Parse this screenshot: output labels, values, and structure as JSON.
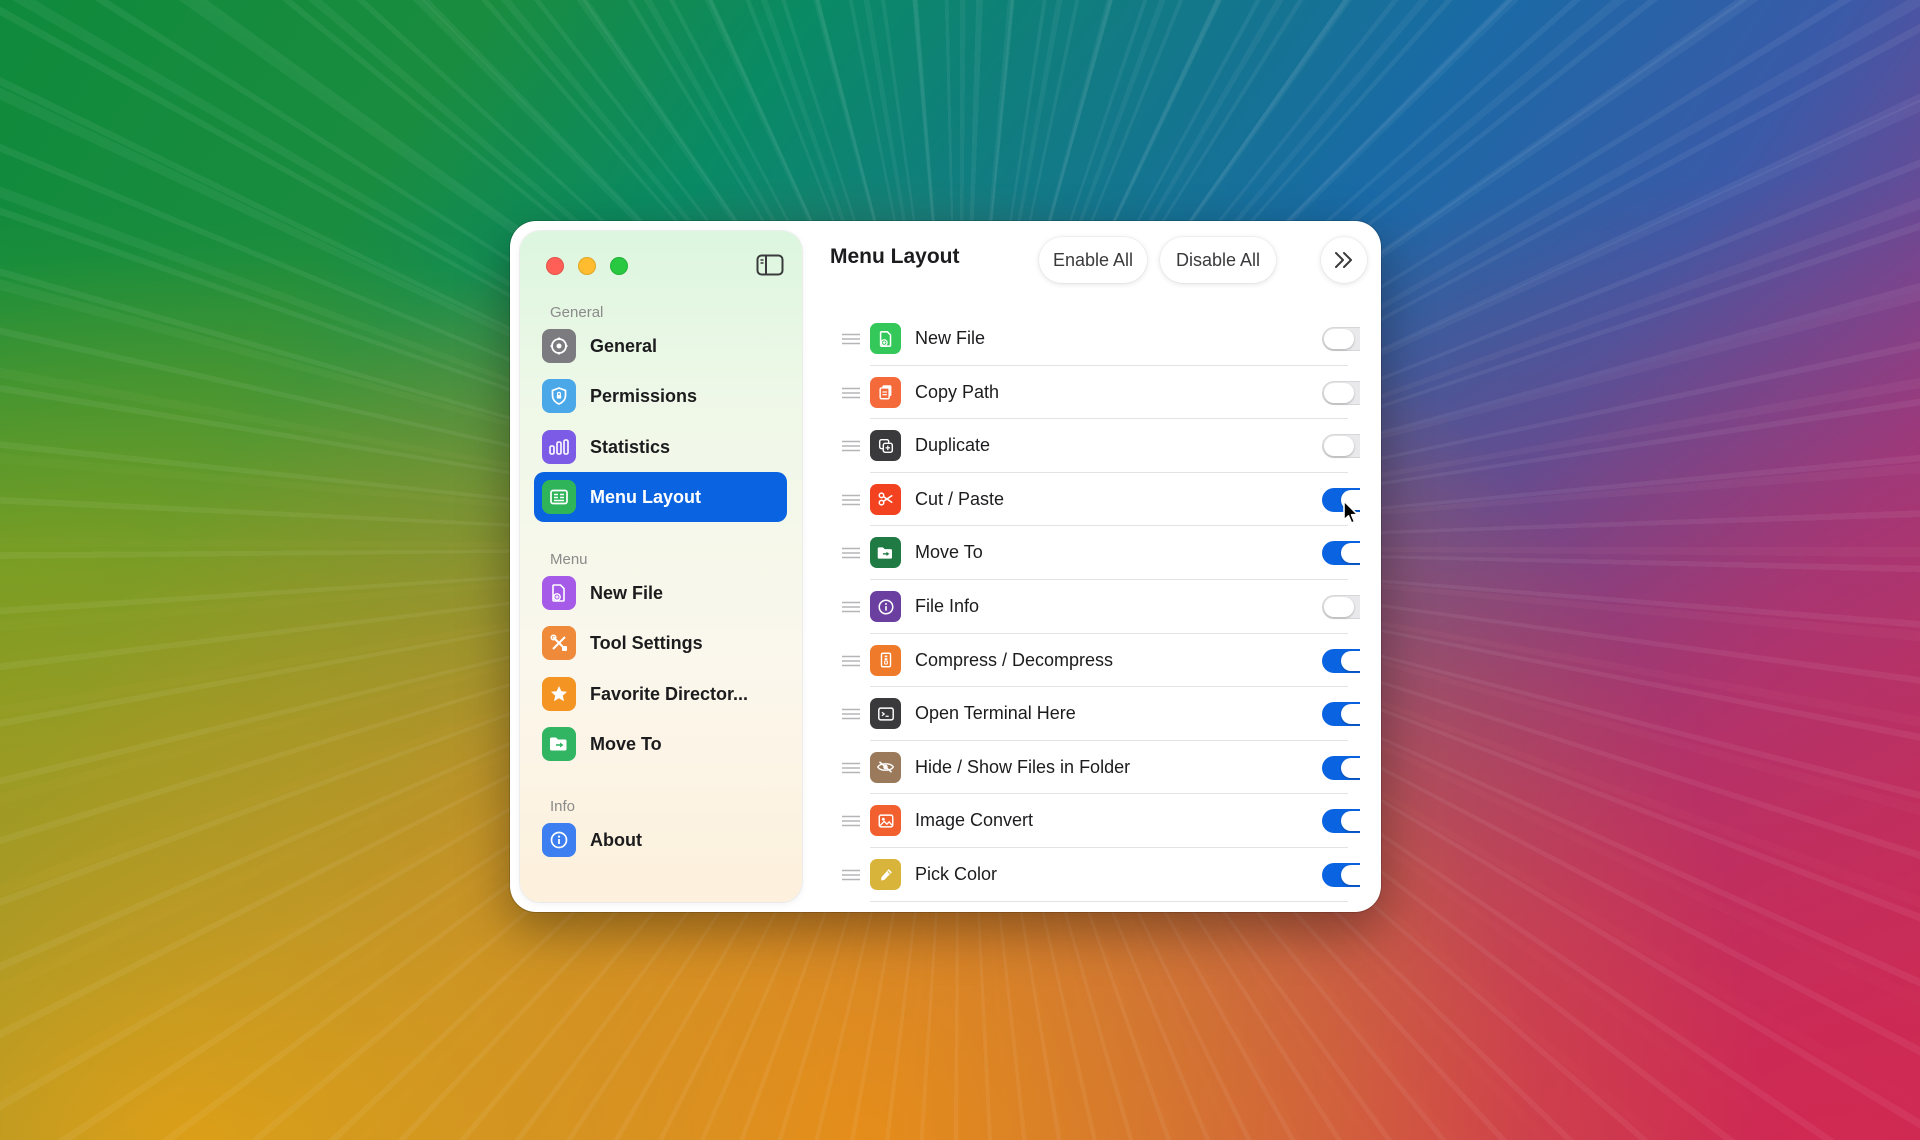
{
  "window": {
    "title": "Menu Layout",
    "enable_all_label": "Enable All",
    "disable_all_label": "Disable All"
  },
  "sidebar": {
    "sections": [
      {
        "header": "General",
        "items": [
          {
            "label": "General",
            "icon": "gear-icon",
            "color": "#7b7b80",
            "active": false
          },
          {
            "label": "Permissions",
            "icon": "shield-icon",
            "color": "#4aa8e8",
            "active": false
          },
          {
            "label": "Statistics",
            "icon": "bar-chart-icon",
            "color": "#7c5ce6",
            "active": false
          },
          {
            "label": "Menu Layout",
            "icon": "menu-layout-icon",
            "color": "#2fb45a",
            "active": true
          }
        ]
      },
      {
        "header": "Menu",
        "items": [
          {
            "label": "New File",
            "icon": "new-file-icon",
            "color": "#a55ae8",
            "active": false
          },
          {
            "label": "Tool Settings",
            "icon": "tools-icon",
            "color": "#ef8a3a",
            "active": false
          },
          {
            "label": "Favorite Director...",
            "icon": "star-icon",
            "color": "#f39423",
            "active": false
          },
          {
            "label": "Move To",
            "icon": "folder-move-icon",
            "color": "#32b563",
            "active": false
          }
        ]
      },
      {
        "header": "Info",
        "items": [
          {
            "label": "About",
            "icon": "info-icon",
            "color": "#3d7ff0",
            "active": false
          }
        ]
      }
    ]
  },
  "menu_items": [
    {
      "label": "New File",
      "icon": "new-file-icon",
      "color": "#34c759",
      "enabled": false
    },
    {
      "label": "Copy Path",
      "icon": "copy-path-icon",
      "color": "#f46a3a",
      "enabled": false
    },
    {
      "label": "Duplicate",
      "icon": "duplicate-icon",
      "color": "#3a3a3c",
      "enabled": false
    },
    {
      "label": "Cut / Paste",
      "icon": "scissors-icon",
      "color": "#f2421f",
      "enabled": true
    },
    {
      "label": "Move To",
      "icon": "folder-move-icon",
      "color": "#1f7a44",
      "enabled": true
    },
    {
      "label": "File Info",
      "icon": "info-icon",
      "color": "#6a3fa0",
      "enabled": false
    },
    {
      "label": "Compress / Decompress",
      "icon": "archive-icon",
      "color": "#ef7a2a",
      "enabled": true
    },
    {
      "label": "Open Terminal Here",
      "icon": "terminal-icon",
      "color": "#3a3a3c",
      "enabled": true
    },
    {
      "label": "Hide / Show Files in Folder",
      "icon": "eye-slash-icon",
      "color": "#9a7a5a",
      "enabled": true
    },
    {
      "label": "Image Convert",
      "icon": "image-icon",
      "color": "#f2602f",
      "enabled": true
    },
    {
      "label": "Pick Color",
      "icon": "eyedropper-icon",
      "color": "#d9b43a",
      "enabled": true
    },
    {
      "label": "",
      "icon": "partial-icon",
      "color": "#9a6ad8",
      "enabled": true
    }
  ]
}
